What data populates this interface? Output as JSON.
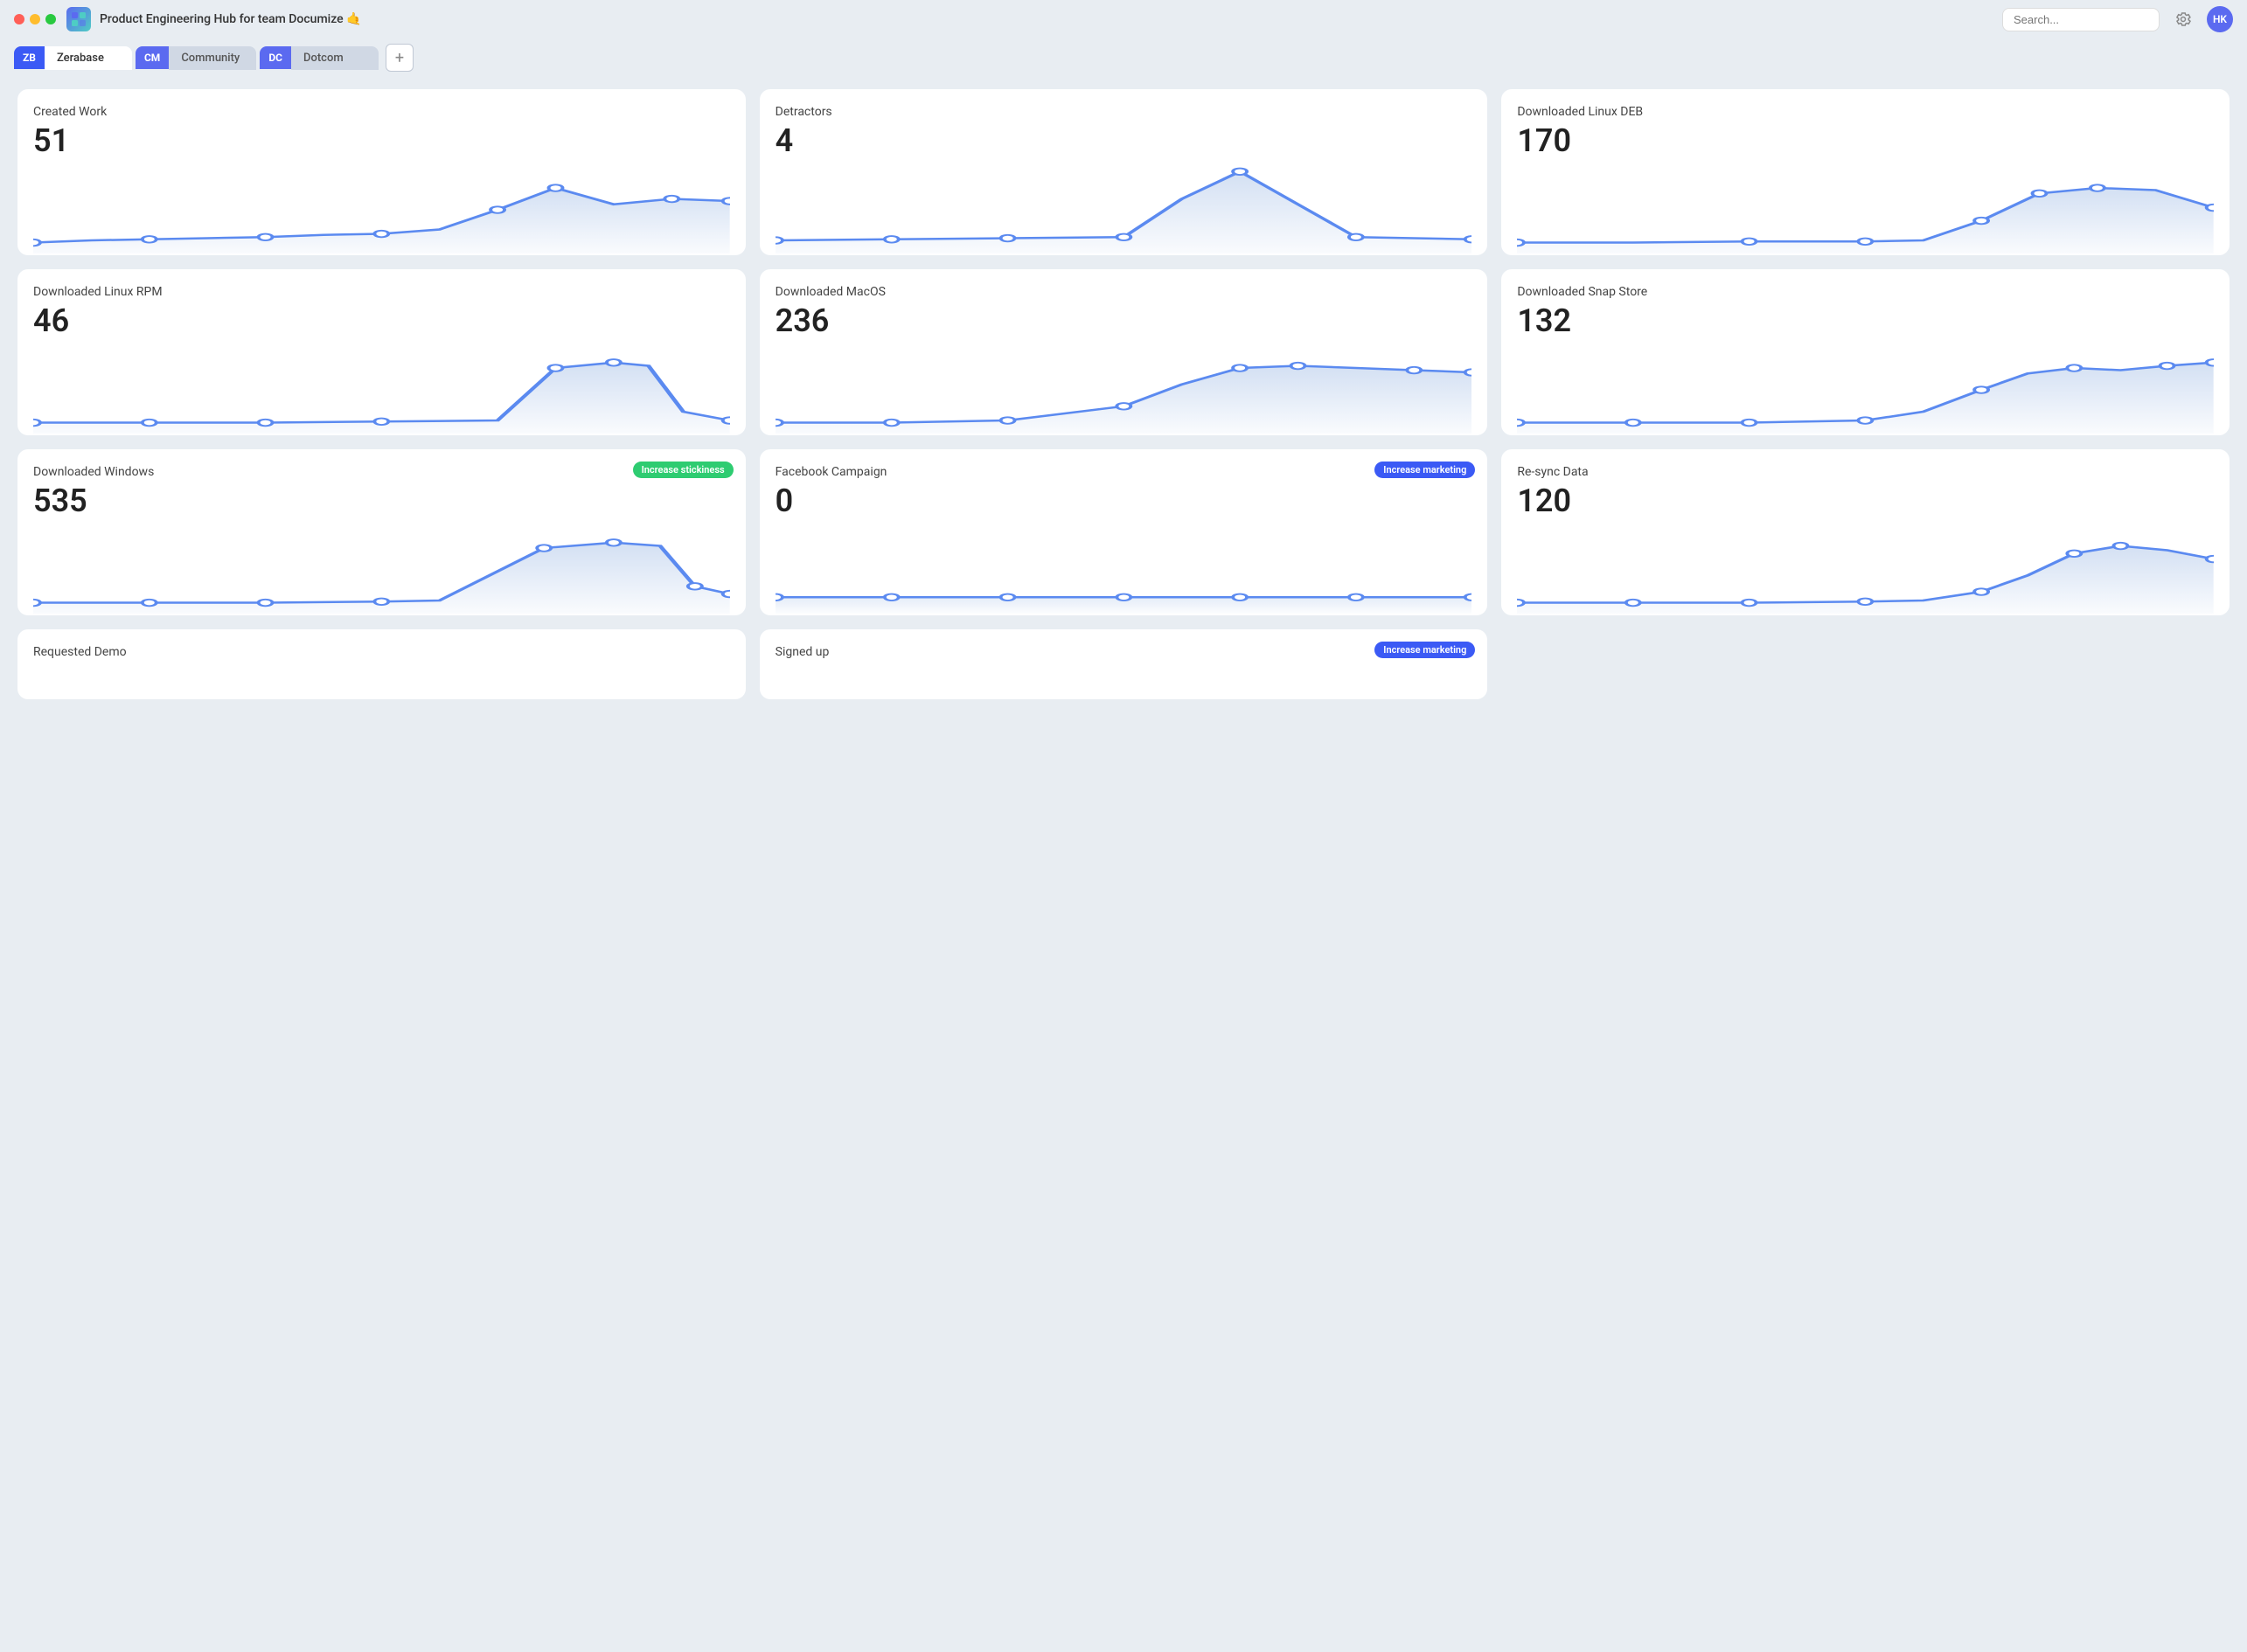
{
  "titlebar": {
    "app_name": "Product Engineering Hub for team Documize 🤙",
    "search_placeholder": "Search...",
    "avatar_initials": "HK"
  },
  "tabs": [
    {
      "id": "zerabase",
      "badge": "ZB",
      "label": "Zerabase",
      "badge_color": "#3b5af5",
      "active": true
    },
    {
      "id": "community",
      "badge": "CM",
      "label": "Community",
      "badge_color": "#5b6af0",
      "active": false
    },
    {
      "id": "dotcom",
      "badge": "DC",
      "label": "Dotcom",
      "badge_color": "#5b6af0",
      "active": false
    }
  ],
  "metrics": [
    {
      "id": "created-work",
      "title": "Created Work",
      "value": "51",
      "badge": null,
      "chart_type": "rising_spike"
    },
    {
      "id": "detractors",
      "title": "Detractors",
      "value": "4",
      "badge": null,
      "chart_type": "single_spike"
    },
    {
      "id": "downloaded-linux-deb",
      "title": "Downloaded Linux DEB",
      "value": "170",
      "badge": null,
      "chart_type": "end_rise"
    },
    {
      "id": "downloaded-linux-rpm",
      "title": "Downloaded Linux RPM",
      "value": "46",
      "badge": null,
      "chart_type": "triangle_spike"
    },
    {
      "id": "downloaded-macos",
      "title": "Downloaded MacOS",
      "value": "236",
      "badge": null,
      "chart_type": "gradual_rise"
    },
    {
      "id": "downloaded-snap-store",
      "title": "Downloaded Snap Store",
      "value": "132",
      "badge": null,
      "chart_type": "step_rise"
    },
    {
      "id": "downloaded-windows",
      "title": "Downloaded Windows",
      "value": "535",
      "badge": {
        "label": "Increase stickiness",
        "color": "green"
      },
      "chart_type": "windows_shape"
    },
    {
      "id": "facebook-campaign",
      "title": "Facebook Campaign",
      "value": "0",
      "badge": {
        "label": "Increase marketing",
        "color": "blue"
      },
      "chart_type": "flat"
    },
    {
      "id": "re-sync-data",
      "title": "Re-sync Data",
      "value": "120",
      "badge": null,
      "chart_type": "late_rise"
    },
    {
      "id": "requested-demo",
      "title": "Requested Demo",
      "value": "",
      "badge": null,
      "chart_type": "flat"
    },
    {
      "id": "signed-up",
      "title": "Signed up",
      "value": "",
      "badge": {
        "label": "Increase marketing",
        "color": "blue"
      },
      "chart_type": "flat"
    }
  ]
}
